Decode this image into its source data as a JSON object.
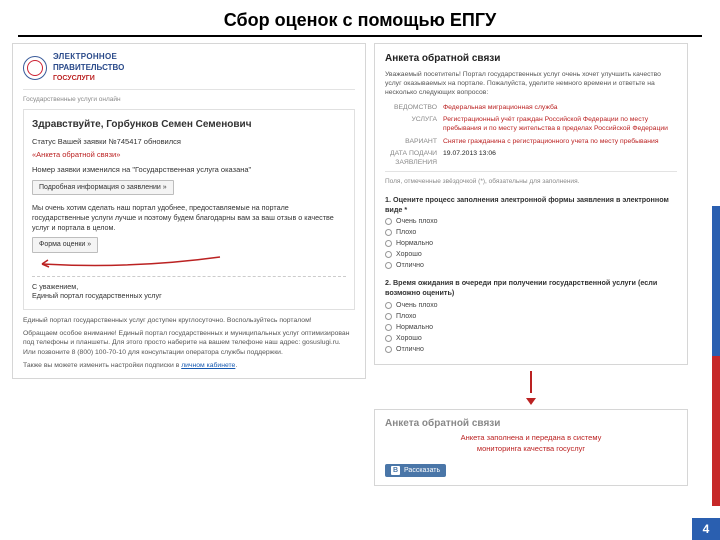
{
  "title": "Сбор оценок с помощью ЕПГУ",
  "page_number": "4",
  "left": {
    "brand": {
      "l1": "ЭЛЕКТРОННОЕ",
      "l2": "ПРАВИТЕЛЬСТВО",
      "l3": "ГОСУСЛУГИ"
    },
    "subheader": "Государственные услуги онлайн",
    "greeting_prefix": "Здравствуйте,",
    "user_name": "Горбунков Семен Семенович",
    "status_line": "Статус Вашей заявки №745417 обновился",
    "service_quote": "«Анкета обратной связи»",
    "service_desc": "Номер заявки изменился на \"Государственная услуга оказана\"",
    "btn_details": "Подробная информация о заявлении »",
    "para1": "Мы очень хотим сделать наш портал удобнее, предоставляемые на портале государственные услуги лучше и поэтому будем благодарны вам за ваш отзыв о качестве услуг и портала в целом.",
    "btn_form": "Форма оценки »",
    "signoff1": "С уважением,",
    "signoff2": "Единый портал государственных услуг",
    "foot1": "Единый портал государственных услуг доступен круглосуточно. Воспользуйтесь порталом!",
    "foot2": "Обращаем особое внимание! Единый портал государственных и муниципальных услуг оптимизирован под телефоны и планшеты. Для этого просто наберите на вашем телефоне наш адрес: gosuslugi.ru. Или позвоните 8 (800) 100-70-10 для консультации оператора службы поддержки.",
    "foot3": "Также вы можете изменить настройки подписки в ",
    "foot3_link": "личном кабинете"
  },
  "right": {
    "heading": "Анкета обратной связи",
    "intro": "Уважаемый посетитель! Портал государственных услуг очень хочет улучшить качество услуг оказываемых на портале. Пожалуйста, уделите немного времени и ответьте на несколько следующих вопросов:",
    "fields": {
      "vedomstvo_label": "ВЕДОМСТВО",
      "vedomstvo": "Федеральная миграционная служба",
      "usluga_label": "УСЛУГА",
      "usluga": "Регистрационный учёт граждан Российской Федерации по месту пребывания и по месту жительства в пределах Российской Федерации",
      "variant_label": "ВАРИАНТ",
      "variant": "Снятие гражданина с регистрационного учета по месту пребывания",
      "date_label": "ДАТА ПОДАЧИ ЗАЯВЛЕНИЯ",
      "date": "19.07.2013 13:06"
    },
    "note": "Поля, отмеченные звёздочкой (*), обязательны для заполнения.",
    "q1": "1. Оцените процесс заполнения электронной формы заявления в электронном виде *",
    "q2": "2. Время ожидания в очереди при получении государственной услуги (если возможно оценить)",
    "opts": [
      "Очень плохо",
      "Плохо",
      "Нормально",
      "Хорошо",
      "Отлично"
    ],
    "panel2_heading": "Анкета обратной связи",
    "success1": "Анкета заполнена и передана в систему",
    "success2": "мониторинга качества госуслуг",
    "vk_label": "Рассказать"
  }
}
